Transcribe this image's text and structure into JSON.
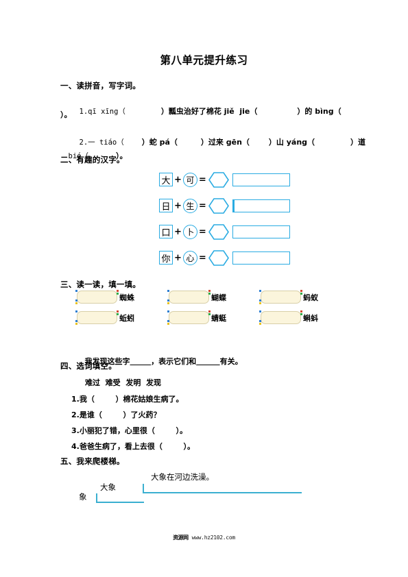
{
  "document": {
    "title": "第八单元提升练习"
  },
  "sections": {
    "one": {
      "heading": "一、读拼音，写字词。",
      "q1_a": "1.qī xīng（",
      "q1_b": "）瓢虫治好了棉花 jiě  jie（",
      "q1_c": "）的 bìng（",
      "q1_d": "）。",
      "q2_a": "2.一 tiáo（",
      "q2_b": "）蛇 pá（",
      "q2_c": "）过来 gēn（",
      "q2_d": "）山 yáng（",
      "q2_e": "）道",
      "q2_f": "bié（",
      "q2_g": "）。"
    },
    "two": {
      "heading": "二、有趣的汉字。",
      "equations": [
        {
          "left": "大",
          "op": "+",
          "right": "可",
          "eq": "="
        },
        {
          "left": "日",
          "op": "+",
          "right": "生",
          "eq": "="
        },
        {
          "left": "口",
          "op": "+",
          "right": "卜",
          "eq": "="
        },
        {
          "left": "你",
          "op": "+",
          "right": "心",
          "eq": "="
        }
      ]
    },
    "three": {
      "heading": "三、读一读，填一填。",
      "items": [
        "蜘蛛",
        "蝴蝶",
        "蚂蚁",
        "蚯蚓",
        "蜻蜓",
        "蝌蚪"
      ],
      "conclusion_a": "我发现这些字",
      "conclusion_blank1": "        ",
      "conclusion_b": "，表示它们和",
      "conclusion_blank2": "         ",
      "conclusion_c": "有关。"
    },
    "four": {
      "heading": "四、选词填空。",
      "word_bank": "难过  难受  发明  发现",
      "questions": [
        "1.我（        ）棉花姑娘生病了。",
        "2.是谁（        ）了火药？",
        "3.小丽犯了错，心里很（        ）。",
        "4.爸爸生病了，看上去很（        ）。"
      ]
    },
    "five": {
      "heading": "五、我来爬楼梯。",
      "step1": "象",
      "step2": "大象",
      "step3": "大象在河边洗澡。"
    }
  },
  "footer": {
    "logo": "资源网",
    "url": "www.hz2102.com"
  },
  "colors": {
    "accent_cyan": "#29ABE2",
    "stair_blue": "#3AAFD0",
    "callout_fill": "#FBF5DC",
    "callout_border": "#D8CFA8"
  }
}
